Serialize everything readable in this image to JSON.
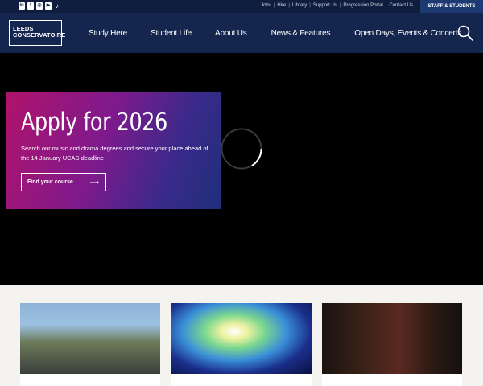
{
  "topbar": {
    "social": [
      {
        "icon": "linkedin-icon",
        "glyph": "in"
      },
      {
        "icon": "facebook-icon",
        "glyph": "f"
      },
      {
        "icon": "instagram-icon",
        "glyph": "◎"
      },
      {
        "icon": "youtube-icon",
        "glyph": "▶"
      },
      {
        "icon": "tiktok-icon",
        "glyph": "♪"
      }
    ],
    "links": [
      "Jobs",
      "Hire",
      "Library",
      "Support Us",
      "Progression Portal",
      "Contact Us"
    ],
    "staff_label": "STAFF & STUDENTS"
  },
  "nav": {
    "logo_line1": "LEEDS",
    "logo_line2": "CONSERVATOIRE",
    "items": [
      "Study Here",
      "Student Life",
      "About Us",
      "News & Features",
      "Open Days, Events & Concerts"
    ]
  },
  "hero": {
    "title": "Apply for 2026",
    "text": "Search our music and drama degrees and secure your place ahead of the 14 January UCAS deadline",
    "cta_label": "Find your course",
    "cta_arrow": "⟶"
  },
  "colors": {
    "topbar": "#0f1d3f",
    "nav": "#14254e",
    "staff": "#1e3a73",
    "promo_start": "#b0136b",
    "promo_end": "#1f2f7a"
  }
}
